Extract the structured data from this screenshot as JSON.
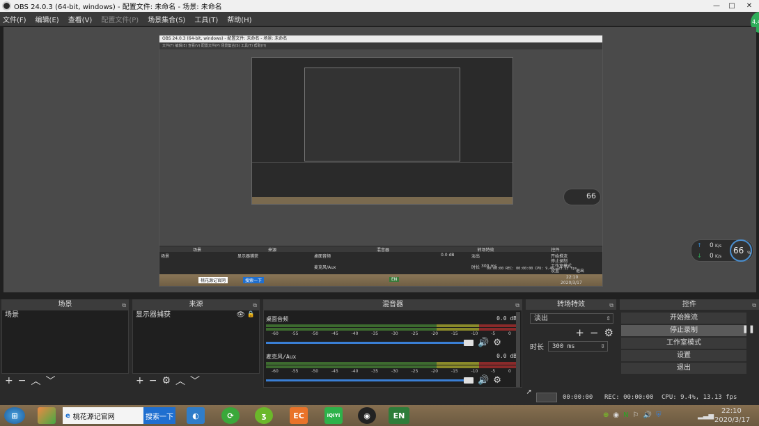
{
  "window": {
    "title": "OBS 24.0.3 (64-bit, windows) - 配置文件: 未命名 - 场景: 未命名",
    "minimize": "—",
    "maximize": "□",
    "close": "✕"
  },
  "menu": [
    "文件(F)",
    "编辑(E)",
    "查看(V)",
    "配置文件(P)",
    "场景集合(S)",
    "工具(T)",
    "帮助(H)"
  ],
  "nested": {
    "title": "OBS 24.0.3 (64-bit, windows) - 配置文件: 未命名 - 场景: 未命名",
    "menu": "文件(F)  编辑(E)  查看(V)  配置文件(P)  场景集合(S)  工具(T)  帮助(H)",
    "docks": [
      "场景",
      "来源",
      "混音器",
      "转场特效",
      "控件"
    ],
    "source": "显示器捕获",
    "scene": "场景",
    "track1": "桌面音频",
    "track2": "麦克风/Aux",
    "db": "0.0 dB",
    "transition": "淡出",
    "duration_label": "时长",
    "duration": "300 ms",
    "controls": [
      "开始推流",
      "停止录制",
      "工作室模式",
      "设置",
      "退出"
    ],
    "status": "00:00:00   REC: 00:00:00   CPU: 9.4%, 13.13 fps",
    "clock_time": "22:10",
    "clock_date": "2020/3/17",
    "speed": "66",
    "speed_unit": "%",
    "up": "0K/s",
    "down": "0K/s",
    "task_ie": "桃花源记官网",
    "task_search": "搜索一下",
    "task_en": "EN"
  },
  "speed_widget": {
    "value": "66",
    "unit": "%",
    "up_value": "0",
    "down_value": "0",
    "rate_unit": "K/s"
  },
  "corner_badge": "4.4",
  "docks": {
    "scenes": {
      "title": "场景",
      "items": [
        "场景"
      ]
    },
    "sources": {
      "title": "来源",
      "items": [
        "显示器捕获"
      ]
    },
    "mixer": {
      "title": "混音器",
      "tracks": [
        {
          "name": "桌面音频",
          "db": "0.0 dB",
          "level": 0
        },
        {
          "name": "麦克风/Aux",
          "db": "0.0 dB",
          "level": 0
        }
      ],
      "scale": [
        "-60",
        "-55",
        "-50",
        "-45",
        "-40",
        "-35",
        "-30",
        "-25",
        "-20",
        "-15",
        "-10",
        "-5",
        "0"
      ]
    },
    "transitions": {
      "title": "转场特效",
      "selected": "淡出",
      "duration_label": "时长",
      "duration": "300 ms"
    },
    "controls": {
      "title": "控件",
      "buttons": [
        "开始推流",
        "停止录制",
        "工作室模式",
        "设置",
        "退出"
      ],
      "active": "停止录制"
    }
  },
  "status": {
    "live_time": "00:00:00",
    "rec": "REC: 00:00:00",
    "cpu": "CPU: 9.4%, 13.13 fps"
  },
  "taskbar": {
    "ie_label": "桃花源记官网",
    "search_button": "搜索一下",
    "en_label": "EN",
    "time": "22:10",
    "date": "2020/3/17",
    "iqiyi": "iQIYI"
  },
  "colors": {
    "accent_blue": "#3a7fd5",
    "meter_green": "#3d6b2f",
    "badge_green": "#2fae5a"
  }
}
